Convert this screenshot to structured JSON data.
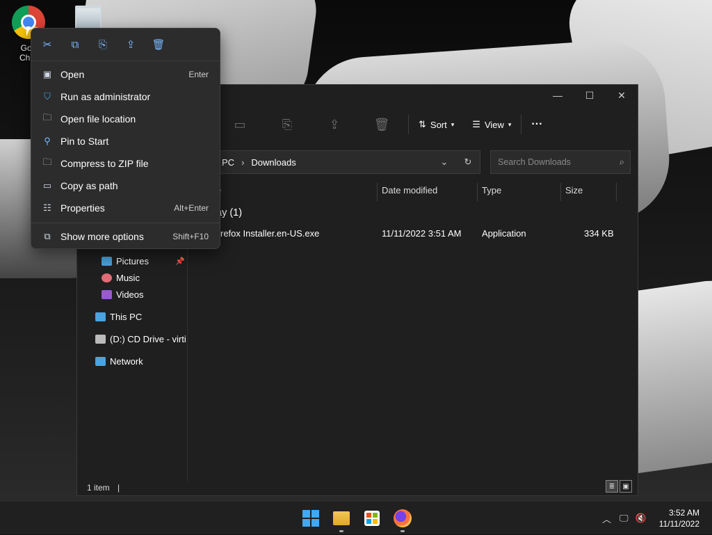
{
  "desktop": {
    "icons": [
      {
        "name": "Google Chrome",
        "label_top": "Goo",
        "label_bottom": "Chro"
      },
      {
        "name": "Recycle Bin",
        "label": ""
      }
    ]
  },
  "explorer": {
    "title": "Downloads",
    "window_controls": {
      "minimize": "—",
      "maximize": "☐",
      "close": "✕"
    },
    "toolbar": {
      "sort_label": "Sort",
      "view_label": "View",
      "more_label": "···"
    },
    "address": {
      "crumbs": [
        "PC",
        "Downloads"
      ],
      "separator": "›"
    },
    "search": {
      "placeholder": "Search Downloads"
    },
    "columns": [
      "e",
      "Date modified",
      "Type",
      "Size"
    ],
    "group": {
      "label": "ay (1)"
    },
    "files": [
      {
        "name": "refox Installer.en-US.exe",
        "date": "11/11/2022 3:51 AM",
        "type": "Application",
        "size": "334 KB"
      }
    ],
    "nav": [
      {
        "label": "Pictures",
        "pinned": true,
        "color": "#4aa3df"
      },
      {
        "label": "Music",
        "pinned": false,
        "color": "#e06c75"
      },
      {
        "label": "Videos",
        "pinned": false,
        "color": "#9b59d0"
      },
      {
        "label": "This PC",
        "pinned": false,
        "color": "#4aa3df"
      },
      {
        "label": "(D:) CD Drive - virti",
        "pinned": false,
        "color": "#bbbbbb"
      },
      {
        "label": "Network",
        "pinned": false,
        "color": "#4aa3df"
      }
    ],
    "status": {
      "count": "1 item"
    }
  },
  "context_menu": {
    "quick_actions": [
      "cut",
      "copy",
      "rename",
      "share",
      "delete"
    ],
    "items": [
      {
        "label": "Open",
        "shortcut": "Enter",
        "icon": "open-icon"
      },
      {
        "label": "Run as administrator",
        "shortcut": "",
        "icon": "shield-icon"
      },
      {
        "label": "Open file location",
        "shortcut": "",
        "icon": "folder-icon"
      },
      {
        "label": "Pin to Start",
        "shortcut": "",
        "icon": "pin-icon"
      },
      {
        "label": "Compress to ZIP file",
        "shortcut": "",
        "icon": "zip-icon"
      },
      {
        "label": "Copy as path",
        "shortcut": "",
        "icon": "path-icon"
      },
      {
        "label": "Properties",
        "shortcut": "Alt+Enter",
        "icon": "properties-icon"
      },
      {
        "label": "Show more options",
        "shortcut": "Shift+F10",
        "icon": "more-options-icon"
      }
    ]
  },
  "taskbar": {
    "clock_time": "3:52 AM",
    "clock_date": "11/11/2022",
    "accent": "#3fa9f5"
  }
}
